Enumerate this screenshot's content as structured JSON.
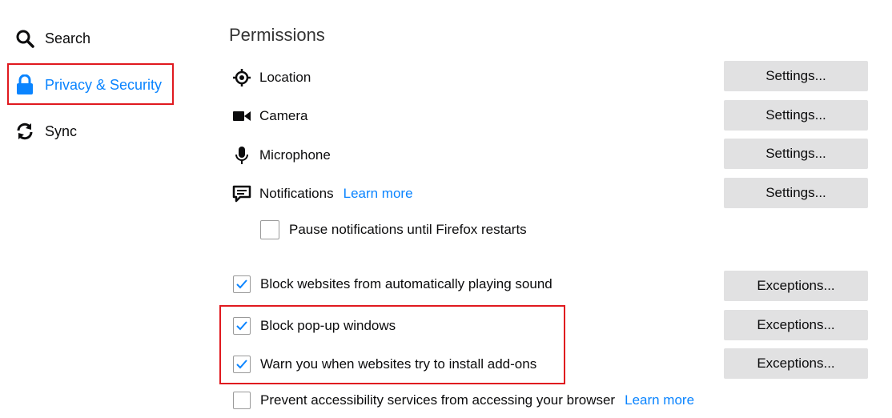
{
  "sidebar": {
    "items": [
      {
        "icon": "search-icon",
        "label": "Search"
      },
      {
        "icon": "lock-icon",
        "label": "Privacy & Security",
        "selected": true
      },
      {
        "icon": "sync-icon",
        "label": "Sync"
      }
    ]
  },
  "section": {
    "title": "Permissions"
  },
  "permissions": [
    {
      "icon": "location-icon",
      "label": "Location",
      "button": "Settings..."
    },
    {
      "icon": "camera-icon",
      "label": "Camera",
      "button": "Settings..."
    },
    {
      "icon": "microphone-icon",
      "label": "Microphone",
      "button": "Settings..."
    },
    {
      "icon": "notifications-icon",
      "label": "Notifications",
      "link": "Learn more",
      "button": "Settings..."
    }
  ],
  "pause_notifications": {
    "label": "Pause notifications until Firefox restarts",
    "checked": false
  },
  "checkboxes": [
    {
      "label": "Block websites from automatically playing sound",
      "checked": true,
      "button": "Exceptions..."
    },
    {
      "label": "Block pop-up windows",
      "checked": true,
      "button": "Exceptions..."
    },
    {
      "label": "Warn you when websites try to install add-ons",
      "checked": true,
      "button": "Exceptions..."
    },
    {
      "label": "Prevent accessibility services from accessing your browser",
      "checked": false,
      "link": "Learn more"
    }
  ],
  "colors": {
    "accent": "#0a84ff",
    "highlight": "#e0191f",
    "button_bg": "#e1e1e2"
  }
}
